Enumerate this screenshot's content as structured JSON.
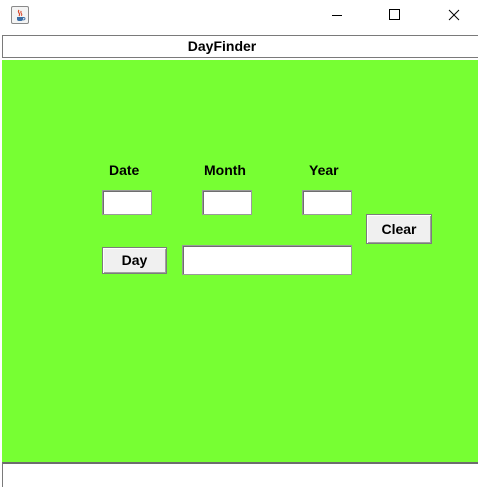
{
  "window": {
    "app_icon": "java-cup-icon",
    "controls": [
      "minimize-icon",
      "maximize-icon",
      "close-icon"
    ]
  },
  "header": {
    "title": "DayFinder"
  },
  "form": {
    "labels": {
      "date": "Date",
      "month": "Month",
      "year": "Year"
    },
    "values": {
      "date": "",
      "month": "",
      "year": "",
      "result": ""
    },
    "buttons": {
      "day": "Day",
      "clear": "Clear"
    }
  },
  "colors": {
    "panel_background": "#77ff33"
  }
}
